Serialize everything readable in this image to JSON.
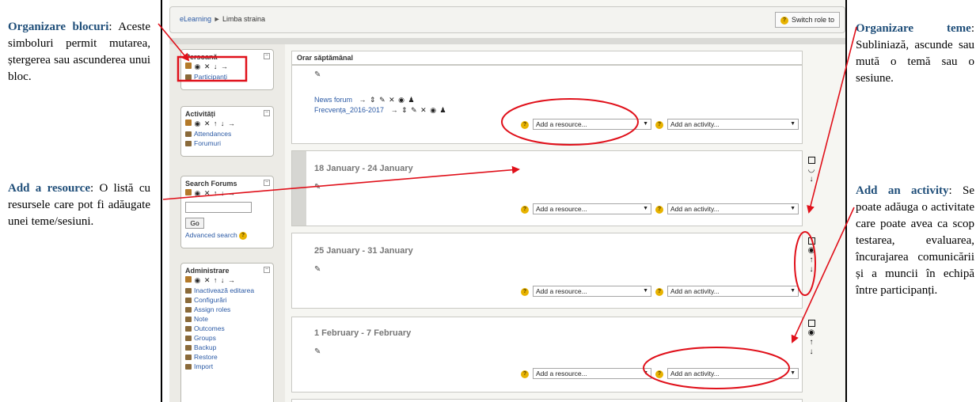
{
  "left_annotations": {
    "blocks_title": "Organizare blocuri",
    "blocks_text": "Aceste simboluri permit mutarea, ștergerea sau ascunderea unui bloc.",
    "resource_title": "Add a resource",
    "resource_text": "O listă cu resursele care pot fi adăugate unei teme/sesiuni."
  },
  "right_annotations": {
    "topics_title": "Organizare teme",
    "topics_text": "Subliniază, ascunde sau mută o temă sau o sesiune.",
    "activity_title": "Add an activity",
    "activity_text": "Se poate adăuga o activitate care poate avea ca scop testarea, evaluarea, încurajarea comunicării și a muncii în echipă între participanți."
  },
  "breadcrumb": {
    "root": "eLearning",
    "separator": "►",
    "current": "Limba straina"
  },
  "switch_role_label": "Switch role to",
  "blocks": {
    "persoane": {
      "title": "Persoană",
      "controls": "◉ ✕ ↓ →",
      "items": [
        "Participanți"
      ]
    },
    "activitati": {
      "title": "Activități",
      "controls": "◉ ✕ ↑ ↓ →",
      "items": [
        "Attendances",
        "Forumuri"
      ]
    },
    "search": {
      "title": "Search Forums",
      "controls": "◉ ✕ ↑ ↓ →",
      "go_label": "Go",
      "advanced_label": "Advanced search"
    },
    "admin": {
      "title": "Administrare",
      "controls": "◉ ✕ ↑ ↓ →",
      "items": [
        "Inactivează editarea",
        "Configurări",
        "Assign roles",
        "Note",
        "Outcomes",
        "Groups",
        "Backup",
        "Restore",
        "Import"
      ]
    }
  },
  "main": {
    "header": "Orar săptămânal",
    "resources": [
      {
        "label": "News forum",
        "controls": "→ ⇕ ✎ ✕ ◉ ♟"
      },
      {
        "label": "Frecvența_2016-2017",
        "controls": "→ ⇕ ✎ ✕ ◉ ♟"
      }
    ],
    "sections": [
      {
        "title": "18 January - 24 January"
      },
      {
        "title": "25 January - 31 January"
      },
      {
        "title": "1 February - 7 February"
      }
    ],
    "add_resource_label": "Add a resource...",
    "add_activity_label": "Add an activity..."
  },
  "colors": {
    "annotation_title": "#1f4e79",
    "link": "#2b5aa5",
    "arrow": "#e0101a",
    "current_section": "#d6d6d2"
  }
}
